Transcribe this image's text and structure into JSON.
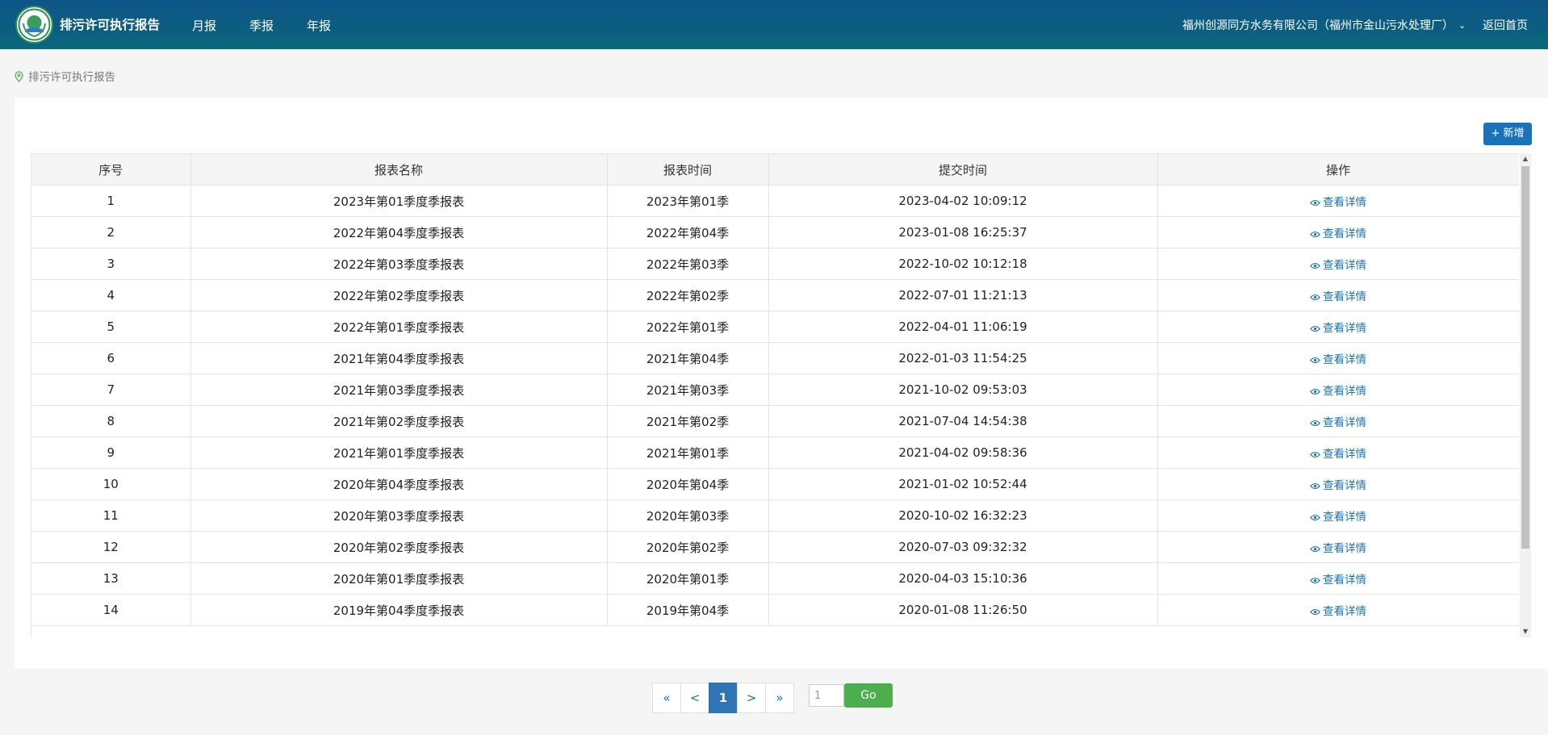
{
  "header": {
    "brand": "排污许可执行报告",
    "nav": [
      "月报",
      "季报",
      "年报"
    ],
    "company": "福州创源同方水务有限公司（福州市金山污水处理厂）",
    "home_link": "返回首页"
  },
  "breadcrumb": "排污许可执行报告",
  "toolbar": {
    "add_label": "+  新增"
  },
  "table": {
    "headers": [
      "序号",
      "报表名称",
      "报表时间",
      "提交时间",
      "操作"
    ],
    "action_label": "查看详情",
    "rows": [
      [
        "1",
        "2023年第01季度季报表",
        "2023年第01季",
        "2023-04-02 10:09:12"
      ],
      [
        "2",
        "2022年第04季度季报表",
        "2022年第04季",
        "2023-01-08 16:25:37"
      ],
      [
        "3",
        "2022年第03季度季报表",
        "2022年第03季",
        "2022-10-02 10:12:18"
      ],
      [
        "4",
        "2022年第02季度季报表",
        "2022年第02季",
        "2022-07-01 11:21:13"
      ],
      [
        "5",
        "2022年第01季度季报表",
        "2022年第01季",
        "2022-04-01 11:06:19"
      ],
      [
        "6",
        "2021年第04季度季报表",
        "2021年第04季",
        "2022-01-03 11:54:25"
      ],
      [
        "7",
        "2021年第03季度季报表",
        "2021年第03季",
        "2021-10-02 09:53:03"
      ],
      [
        "8",
        "2021年第02季度季报表",
        "2021年第02季",
        "2021-07-04 14:54:38"
      ],
      [
        "9",
        "2021年第01季度季报表",
        "2021年第01季",
        "2021-04-02 09:58:36"
      ],
      [
        "10",
        "2020年第04季度季报表",
        "2020年第04季",
        "2021-01-02 10:52:44"
      ],
      [
        "11",
        "2020年第03季度季报表",
        "2020年第03季",
        "2020-10-02 16:32:23"
      ],
      [
        "12",
        "2020年第02季度季报表",
        "2020年第02季",
        "2020-07-03 09:32:32"
      ],
      [
        "13",
        "2020年第01季度季报表",
        "2020年第01季",
        "2020-04-03 15:10:36"
      ],
      [
        "14",
        "2019年第04季度季报表",
        "2019年第04季",
        "2020-01-08 11:26:50"
      ]
    ]
  },
  "pagination": {
    "first": "«",
    "prev": "<",
    "current": "1",
    "next": ">",
    "last": "»",
    "input_value": "1",
    "go_label": "Go"
  },
  "colors": {
    "header": "#0f5688",
    "accent": "#1a73b8",
    "go": "#4cae4c"
  }
}
